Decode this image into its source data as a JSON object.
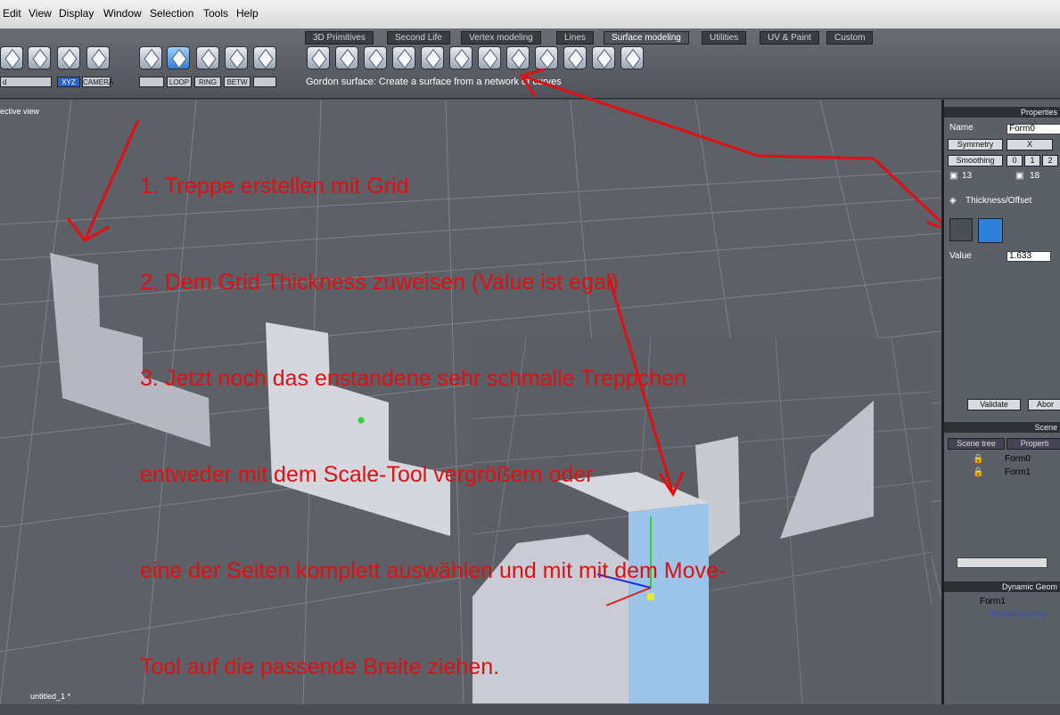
{
  "menu": [
    "Edit",
    "View",
    "Display",
    "Window",
    "Selection",
    "Tools",
    "Help"
  ],
  "tabs": [
    "3D Primitives",
    "Second Life",
    "Vertex modeling",
    "Lines",
    "Surface modeling",
    "Utilities",
    "UV & Paint",
    "Custom"
  ],
  "active_tab": "Surface modeling",
  "toolbar": {
    "view_select": "d",
    "coord_labels": [
      "XYZ",
      "CAMERA"
    ],
    "selection_buttons": [
      "LOOP",
      "RING",
      "BETW"
    ],
    "hint": "Gordon surface: Create a surface from a network of curves"
  },
  "viewport": {
    "label": "ective view",
    "annotation_lines": [
      "1. Treppe erstellen mit Grid",
      "2. Dem Grid Thickness zuweisen (Value ist egal)",
      "3. Jetzt noch das enstandene sehr schmalle Treppchen",
      "entweder mit dem Scale-Tool vergrößern oder",
      "eine der Seiten komplett auswählen und mit mit dem Move-",
      "Tool auf die passende Breite ziehen."
    ],
    "bottom_tab": "untitled_1 *"
  },
  "properties": {
    "title": "Properties",
    "name_label": "Name",
    "name_value": "Form0",
    "symmetry_label": "Symmetry",
    "symmetry_value": "X",
    "smoothing_label": "Smoothing",
    "smoothing_values": [
      "0",
      "1",
      "2"
    ],
    "count_a": "13",
    "count_b": "18",
    "section": "Thickness/Offset",
    "value_label": "Value",
    "value": "1.633",
    "validate": "Validate",
    "abort": "Abor"
  },
  "scene": {
    "title": "Scene",
    "tabs": [
      "Scene tree",
      "Properti"
    ],
    "items": [
      "Form0",
      "Form1"
    ]
  },
  "dynamic": {
    "title": "Dynamic Geom",
    "items": [
      "Form1",
      "Form0 (contro"
    ]
  },
  "colors": {
    "annotation": "#e20e10",
    "accent": "#2f7fd8"
  }
}
